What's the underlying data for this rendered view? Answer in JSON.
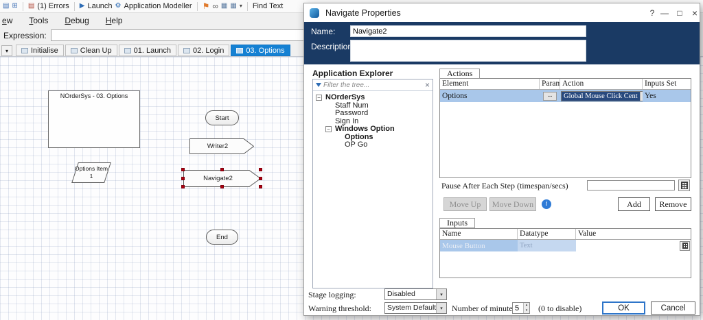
{
  "colors": {
    "header_navy": "#1a3a64",
    "selection_blue": "#a9c7ea",
    "combo_selected_navy": "#28497e",
    "active_tab_blue": "#1581d3",
    "handle_red": "#b00010",
    "info_blue": "#2f7bd6"
  },
  "icons": {
    "page": "▤",
    "window_grid": "⊞",
    "errors_list": "▤",
    "launch_arrow": "▶",
    "modeller_gear": "⚙",
    "flag": "⚑",
    "glasses": "∞",
    "grid": "▦",
    "dropdown_arrow": "▾",
    "spin_up": "▴",
    "spin_down": "▾",
    "help": "?",
    "minimize": "—",
    "maximize": "□",
    "close": "×",
    "clear": "×",
    "ellipsis": "...",
    "info": "i",
    "collapse": "−"
  },
  "toolbar": {
    "errors": "(1) Errors",
    "launch": "Launch",
    "app_modeller": "Application Modeller",
    "find_text": "Find Text"
  },
  "menubar": {
    "items": [
      {
        "label": "ew"
      },
      {
        "label": "Tools"
      },
      {
        "label": "Debug"
      },
      {
        "label": "Help"
      }
    ]
  },
  "expression": {
    "label": "Expression:",
    "value": ""
  },
  "tabs": {
    "items": [
      {
        "label": "Initialise"
      },
      {
        "label": "Clean Up"
      },
      {
        "label": "01. Launch"
      },
      {
        "label": "02. Login"
      },
      {
        "label": "03. Options"
      }
    ]
  },
  "canvas": {
    "note_text": "NOrderSys - 03. Options",
    "start_label": "Start",
    "writer_label": "Writer2",
    "data_item_line1": "Options Item",
    "data_item_line2": "1",
    "navigate_label": "Navigate2",
    "end_label": "End"
  },
  "dialog": {
    "title": "Navigate Properties",
    "name_label": "Name:",
    "name_value": "Navigate2",
    "description_label": "Description:",
    "description_value": "",
    "explorer": {
      "title": "Application Explorer",
      "filter_placeholder": "Filter the tree...",
      "tree": [
        {
          "label": "NOrderSys"
        },
        {
          "label": "Staff Num"
        },
        {
          "label": "Password"
        },
        {
          "label": "Sign In"
        },
        {
          "label": "Windows Option"
        },
        {
          "label": "Options"
        },
        {
          "label": "OP Go"
        }
      ]
    },
    "actions": {
      "group_label": "Actions",
      "columns": [
        "Element",
        "Params",
        "Action",
        "Inputs Set"
      ],
      "row": {
        "element": "Options",
        "action": "Global Mouse Click Cent",
        "inputs_set": "Yes"
      },
      "pause_label": "Pause After Each Step (timespan/secs)",
      "pause_value": "",
      "move_up": "Move Up",
      "move_down": "Move Down",
      "add": "Add",
      "remove": "Remove"
    },
    "inputs": {
      "group_label": "Inputs",
      "columns": [
        "Name",
        "Datatype",
        "Value"
      ],
      "row": {
        "name": "Mouse Button",
        "datatype": "Text",
        "value": ""
      }
    },
    "footer": {
      "stage_logging_label": "Stage logging:",
      "stage_logging_value": "Disabled",
      "warning_threshold_label": "Warning threshold:",
      "warning_threshold_value": "System Default",
      "minutes_label": "Number of minutes",
      "minutes_value": "5",
      "disable_hint": "(0 to disable)",
      "ok": "OK",
      "cancel": "Cancel"
    }
  }
}
